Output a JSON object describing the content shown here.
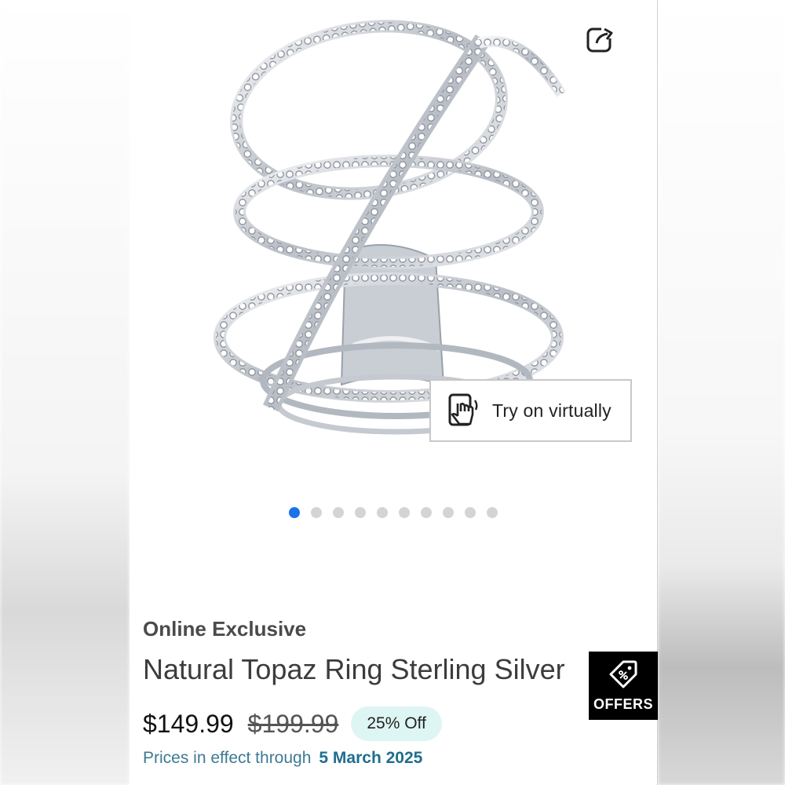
{
  "product": {
    "eyebrow": "Online Exclusive",
    "title": "Natural Topaz Ring Sterling Silver",
    "price": "$149.99",
    "was_price": "$199.99",
    "discount_badge": "25% Off",
    "effect_label": "Prices in effect through",
    "effect_date": "5 March 2025"
  },
  "gallery": {
    "tryon_label": "Try on virtually",
    "tryon_icon": "hand-phone-icon",
    "share_icon": "share-icon",
    "image_count": 10,
    "active_index": 0
  },
  "offers": {
    "label": "OFFERS",
    "icon": "tag-percent-icon"
  },
  "colors": {
    "accent": "#1a73e8",
    "badge_bg": "#def6f3",
    "link": "#3d7a93",
    "offers_bg": "#000000"
  }
}
